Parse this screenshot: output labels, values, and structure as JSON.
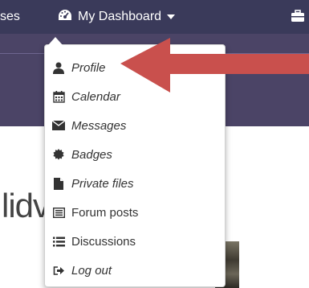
{
  "topbar": {
    "left_crop_text": "ses",
    "dashboard_label": "My Dashboard",
    "icons": {
      "dashboard": "dashboard-gauge-icon",
      "caret": "caret-down-icon",
      "briefcase": "briefcase-icon"
    }
  },
  "background": {
    "heading_fragment": "lidv"
  },
  "menu": {
    "items": [
      {
        "label": "Profile",
        "icon": "user-icon",
        "italic": true
      },
      {
        "label": "Calendar",
        "icon": "calendar-icon",
        "italic": true
      },
      {
        "label": "Messages",
        "icon": "envelope-icon",
        "italic": true
      },
      {
        "label": "Badges",
        "icon": "certificate-icon",
        "italic": true
      },
      {
        "label": "Private files",
        "icon": "file-icon",
        "italic": true
      },
      {
        "label": "Forum posts",
        "icon": "list-alt-icon",
        "italic": false
      },
      {
        "label": "Discussions",
        "icon": "list-icon",
        "italic": false
      },
      {
        "label": "Log out",
        "icon": "sign-out-icon",
        "italic": true
      }
    ]
  },
  "colors": {
    "topbar": "#3a3a5a",
    "band": "#4b4466",
    "arrow": "#c9504d"
  }
}
